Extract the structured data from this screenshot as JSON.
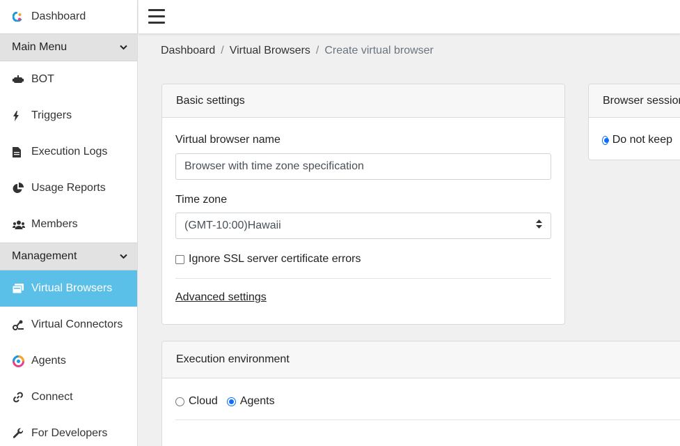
{
  "sidebar": {
    "dashboard": "Dashboard",
    "main_menu": "Main Menu",
    "main_items": [
      {
        "label": "BOT",
        "icon": "robot-icon"
      },
      {
        "label": "Triggers",
        "icon": "bolt-icon"
      },
      {
        "label": "Execution Logs",
        "icon": "file-icon"
      },
      {
        "label": "Usage Reports",
        "icon": "pie-chart-icon"
      },
      {
        "label": "Members",
        "icon": "users-icon"
      }
    ],
    "management": "Management",
    "mgmt_items": [
      {
        "label": "Virtual Browsers",
        "icon": "browser-windows-icon",
        "active": true
      },
      {
        "label": "Virtual Connectors",
        "icon": "connector-icon"
      },
      {
        "label": "Agents",
        "icon": "agent-logo-icon"
      },
      {
        "label": "Connect",
        "icon": "link-icon"
      },
      {
        "label": "For Developers",
        "icon": "wrench-icon"
      }
    ]
  },
  "breadcrumb": {
    "items": [
      "Dashboard",
      "Virtual Browsers"
    ],
    "current": "Create virtual browser"
  },
  "basic": {
    "title": "Basic settings",
    "name_label": "Virtual browser name",
    "name_value": "Browser with time zone specification",
    "tz_label": "Time zone",
    "tz_value": "(GMT-10:00)Hawaii",
    "ssl_label": "Ignore SSL server certificate errors",
    "ssl_checked": false,
    "advanced_link": "Advanced settings"
  },
  "session": {
    "title": "Browser session",
    "option": "Do not keep",
    "selected": true
  },
  "execution": {
    "title": "Execution environment",
    "options": [
      "Cloud",
      "Agents"
    ],
    "selected": "Agents"
  },
  "colors": {
    "active_bg": "#5bc0e8",
    "radio_accent": "#0d6efd"
  }
}
